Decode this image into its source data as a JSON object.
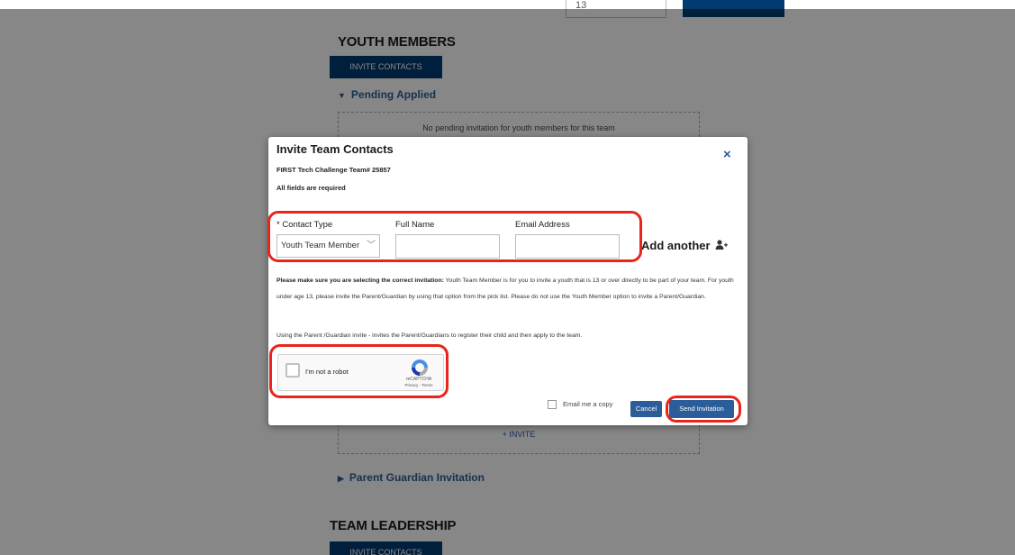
{
  "background": {
    "top_input_value": "13",
    "youth_heading": "YOUTH MEMBERS",
    "invite_contacts_label": "INVITE CONTACTS",
    "pending_label": "Pending Applied",
    "pending_message": "No pending invitation for youth members for this team",
    "plus_invite_label": "+ INVITE",
    "parent_invitation_label": "Parent Guardian Invitation",
    "leadership_heading": "TEAM LEADERSHIP",
    "leadership_invite_label": "INVITE CONTACTS"
  },
  "modal": {
    "title": "Invite Team Contacts",
    "close_symbol": "×",
    "team_line": "FIRST Tech Challenge Team# 25857",
    "required_note": "All fields are required",
    "contact_type_label": "* Contact Type",
    "contact_type_value": "Youth Team Member",
    "full_name_label": "Full Name",
    "full_name_value": "",
    "email_label": "Email Address",
    "email_value": "",
    "add_another_label": "Add another",
    "notice_bold": "Please make sure you are selecting the correct invitation:",
    "notice_rest": " Youth Team Member is for you to invite a youth that is 13 or over directly to be part of your team. For youth under age 13, please invite the Parent/Guardian by using that option from the pick list. Please do not use the Youth Member option to invite a Parent/Guardian.",
    "parent_note": "Using the Parent /Guardian invite - invites the Parent/Guardians to register their child and then apply to the team.",
    "captcha_label": "I'm not a robot",
    "captcha_brand": "reCAPTCHA",
    "captcha_links": "Privacy - Terms",
    "email_copy_label": "Email me a copy",
    "cancel_label": "Cancel",
    "send_label": "Send Invitation"
  },
  "colors": {
    "accent": "#2a5d9a",
    "navy": "#003c71",
    "annotation": "#e8241b"
  },
  "icons": [
    "close-icon",
    "chevron-down-icon",
    "add-user-icon",
    "recaptcha-icon",
    "caret-down-icon",
    "caret-right-icon"
  ]
}
